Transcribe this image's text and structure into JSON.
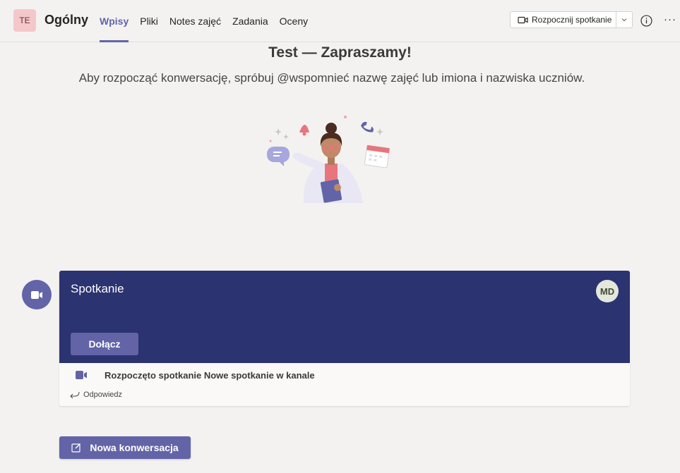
{
  "header": {
    "team_initials": "TE",
    "channel_name": "Ogólny",
    "tabs": [
      {
        "label": "Wpisy",
        "active": true
      },
      {
        "label": "Pliki",
        "active": false
      },
      {
        "label": "Notes zajęć",
        "active": false
      },
      {
        "label": "Zadania",
        "active": false
      },
      {
        "label": "Oceny",
        "active": false
      }
    ],
    "meet_button_label": "Rozpocznij spotkanie",
    "more_label": "···"
  },
  "welcome": {
    "title": "Test — Zapraszamy!",
    "subtitle": "Aby rozpocząć konwersację, spróbuj @wspomnieć nazwę zajęć lub imiona i nazwiska uczniów."
  },
  "meeting_card": {
    "title": "Spotkanie",
    "user_initials": "MD",
    "join_label": "Dołącz",
    "event_text": "Rozpoczęto spotkanie Nowe spotkanie w kanale",
    "reply_label": "Odpowiedz"
  },
  "new_conversation_label": "Nowa konwersacja",
  "colors": {
    "accent": "#6264a7",
    "card_header": "#2b3370",
    "background": "#f3f2f1"
  },
  "icons": [
    "video-camera-icon",
    "chevron-down-icon",
    "info-icon",
    "more-icon",
    "reply-arrow-icon",
    "compose-icon"
  ]
}
